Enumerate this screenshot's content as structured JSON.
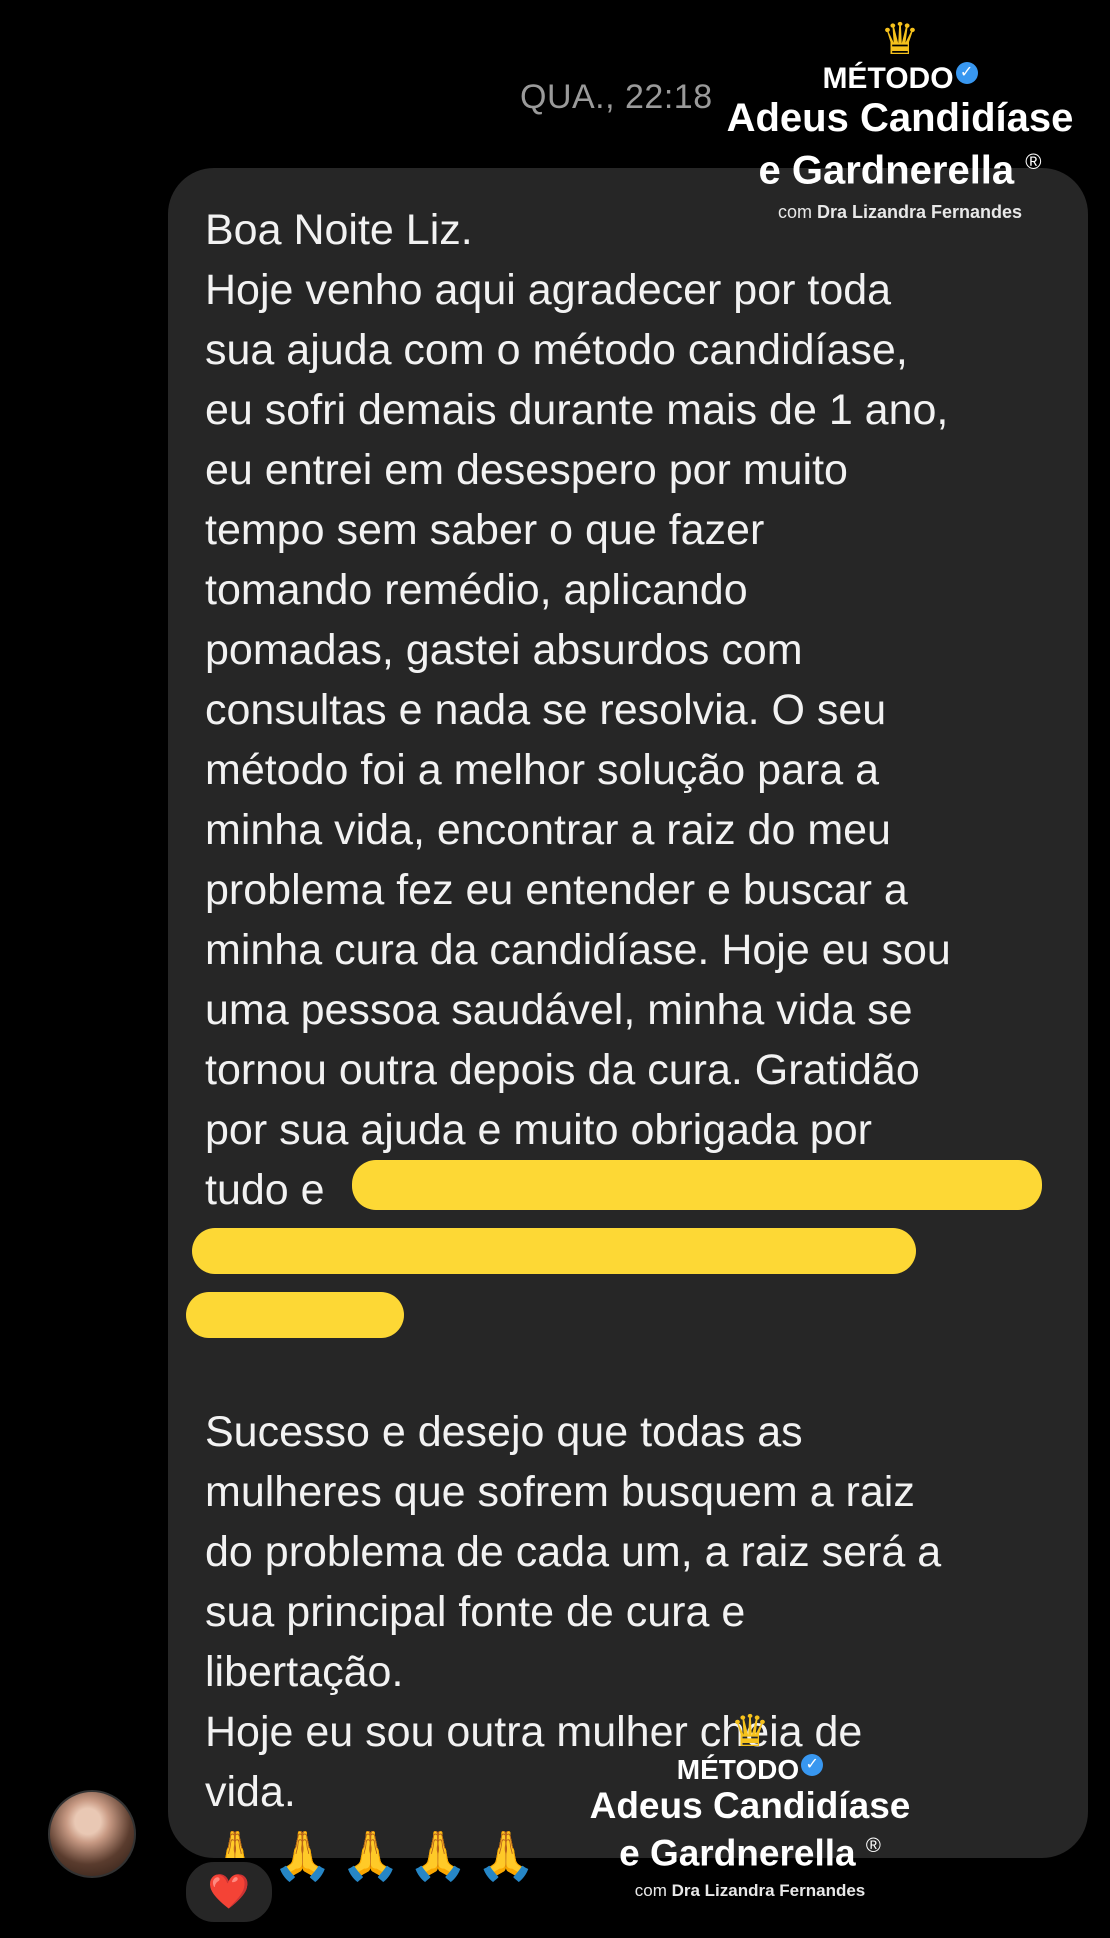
{
  "timestamp": "QUA., 22:18",
  "message": {
    "lines_top": [
      "Boa Noite Liz.",
      "Hoje venho aqui agradecer por toda",
      "sua ajuda com o método candidíase,",
      "eu sofri demais durante mais de 1 ano,",
      "eu entrei em desespero por muito",
      "tempo sem saber o que fazer",
      "tomando remédio, aplicando",
      "pomadas, gastei absurdos com",
      "consultas e nada se resolvia. O seu",
      "método foi a melhor solução para a",
      "minha vida, encontrar a raiz do meu",
      "problema fez eu entender e buscar a",
      "minha cura da candidíase. Hoje eu sou",
      "uma pessoa saudável, minha vida se",
      "tornou outra depois da cura. Gratidão",
      "por sua ajuda e muito obrigada por",
      "tudo e"
    ],
    "lines_bottom": [
      "Sucesso e desejo que todas as",
      "mulheres que sofrem busquem a raiz",
      "do problema de cada um, a raiz será a",
      "sua principal fonte de cura e",
      "libertação.",
      "Hoje eu sou outra mulher cheia de",
      "vida."
    ],
    "emojis": "🙏🙏🙏🙏🙏"
  },
  "reaction": "❤️",
  "watermark": {
    "crown": "♛",
    "metodo": "MÉTODO",
    "verified": "✓",
    "title_line1": "Adeus Candidíase",
    "title_line2": "e Gardnerella",
    "registered": "®",
    "sub_prefix": "com",
    "sub_name": "Dra Lizandra Fernandes"
  },
  "colors": {
    "bubble": "#262626",
    "highlight": "#FDD835",
    "timestamp": "#9a9a9a",
    "crown": "#f6c21c",
    "verified": "#3897f0"
  }
}
